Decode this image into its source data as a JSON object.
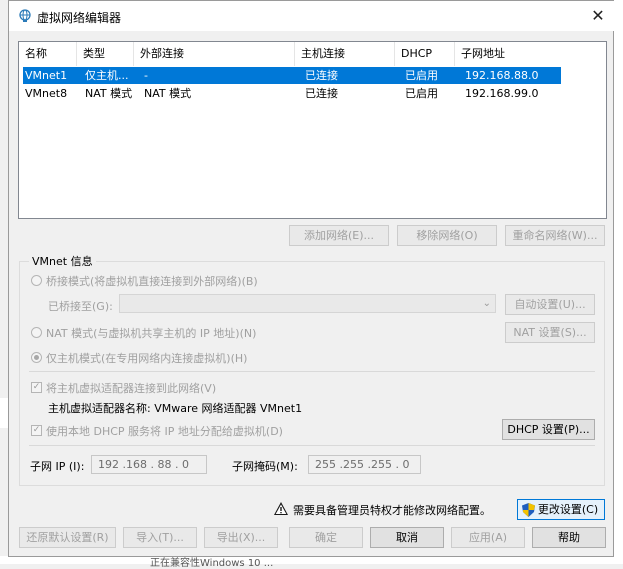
{
  "window": {
    "title": "虚拟网络编辑器",
    "close_glyph": "✕"
  },
  "backdrop": {
    "bottom_text": "正在兼容性Windows 10 ..."
  },
  "table": {
    "headers": [
      "名称",
      "类型",
      "外部连接",
      "主机连接",
      "DHCP",
      "子网地址"
    ],
    "rows": [
      {
        "name": "VMnet1",
        "type": "仅主机...",
        "external": "-",
        "host": "已连接",
        "dhcp": "已启用",
        "subnet": "192.168.88.0",
        "selected": true
      },
      {
        "name": "VMnet8",
        "type": "NAT 模式",
        "external": "NAT 模式",
        "host": "已连接",
        "dhcp": "已启用",
        "subnet": "192.168.99.0",
        "selected": false
      }
    ]
  },
  "list_buttons": {
    "add": "添加网络(E)...",
    "remove": "移除网络(O)",
    "rename": "重命名网络(W)..."
  },
  "vmnet_info": {
    "group_title": "VMnet 信息",
    "bridge_mode": "桥接模式(将虚拟机直接连接到外部网络)(B)",
    "bridged_to_label": "已桥接至(G):",
    "auto_settings": "自动设置(U)...",
    "nat_mode": "NAT 模式(与虚拟机共享主机的 IP 地址)(N)",
    "nat_settings": "NAT 设置(S)...",
    "host_only_mode": "仅主机模式(在专用网络内连接虚拟机)(H)",
    "connect_adapter": "将主机虚拟适配器连接到此网络(V)",
    "adapter_name": "主机虚拟适配器名称: VMware 网络适配器 VMnet1",
    "use_dhcp": "使用本地 DHCP 服务将 IP 地址分配给虚拟机(D)",
    "dhcp_settings": "DHCP 设置(P)...",
    "subnet_ip_label": "子网 IP (I):",
    "subnet_ip": "192 .168 . 88 . 0",
    "subnet_mask_label": "子网掩码(M):",
    "subnet_mask": "255 .255 .255 . 0"
  },
  "admin_notice": {
    "text": "需要具备管理员特权才能修改网络配置。",
    "change_settings": "更改设置(C)",
    "warning_icon": "warning-icon",
    "shield_icon": "shield-icon"
  },
  "footer": {
    "restore": "还原默认设置(R)",
    "import": "导入(T)...",
    "export": "导出(X)...",
    "ok": "确定",
    "cancel": "取消",
    "apply": "应用(A)",
    "help": "帮助"
  },
  "colors": {
    "selection": "#0078d7",
    "disabled_text": "#a0a0a0",
    "shield_blue": "#1f5fbf",
    "shield_yellow": "#f2c200"
  }
}
